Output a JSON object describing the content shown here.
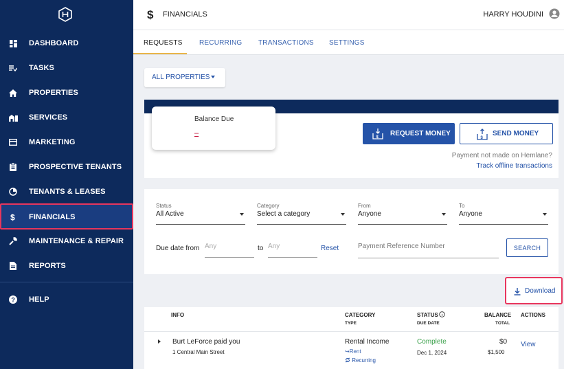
{
  "sidebar": {
    "logo_icon": "hexagon-logo-icon",
    "items": [
      {
        "label": "DASHBOARD",
        "icon": "dashboard-icon"
      },
      {
        "label": "TASKS",
        "icon": "tasks-icon"
      },
      {
        "label": "PROPERTIES",
        "icon": "home-icon"
      },
      {
        "label": "SERVICES",
        "icon": "services-icon"
      },
      {
        "label": "MARKETING",
        "icon": "marketing-icon"
      },
      {
        "label": "PROSPECTIVE TENANTS",
        "icon": "clipboard-icon"
      },
      {
        "label": "TENANTS & LEASES",
        "icon": "pie-icon"
      },
      {
        "label": "FINANCIALS",
        "icon": "dollar-icon",
        "active": true
      },
      {
        "label": "MAINTENANCE & REPAIR",
        "icon": "wrench-icon"
      },
      {
        "label": "REPORTS",
        "icon": "report-icon"
      }
    ],
    "help": {
      "label": "HELP",
      "icon": "help-icon"
    }
  },
  "header": {
    "title": "FINANCIALS",
    "user_name": "HARRY HOUDINI"
  },
  "tabs": [
    {
      "label": "REQUESTS",
      "active": true
    },
    {
      "label": "RECURRING"
    },
    {
      "label": "TRANSACTIONS"
    },
    {
      "label": "SETTINGS"
    }
  ],
  "property_filter": {
    "label": "ALL PROPERTIES"
  },
  "balance": {
    "title": "Balance Due",
    "value": "–",
    "request_label": "REQUEST MONEY",
    "send_label": "SEND MONEY",
    "offline_note": "Payment not made on Hemlane?",
    "offline_link": "Track offline transactions"
  },
  "filters": {
    "status": {
      "caption": "Status",
      "value": "All Active"
    },
    "category": {
      "caption": "Category",
      "value": "Select a category"
    },
    "from": {
      "caption": "From",
      "value": "Anyone"
    },
    "to": {
      "caption": "To",
      "value": "Anyone"
    },
    "due_label": "Due date from",
    "date_from_placeholder": "Any",
    "to_label": "to",
    "date_to_placeholder": "Any",
    "reset_label": "Reset",
    "payref_placeholder": "Payment Reference Number",
    "search_label": "SEARCH"
  },
  "download": {
    "label": "Download"
  },
  "table": {
    "headers": {
      "info": "INFO",
      "category": "CATEGORY",
      "category_sub": "TYPE",
      "status": "STATUS",
      "status_sub": "DUE DATE",
      "balance": "BALANCE",
      "balance_sub": "TOTAL",
      "actions": "ACTIONS"
    },
    "rows": [
      {
        "title": "Burt LeForce paid you",
        "address": "1 Central Main Street",
        "category": "Rental Income",
        "type": "↪Rent",
        "recurring": "Recurring",
        "status": "Complete",
        "due_date": "Dec 1, 2024",
        "balance": "$0",
        "total": "$1,500",
        "action": "View"
      }
    ]
  },
  "colors": {
    "sidebar_bg": "#0d2a5c",
    "accent_blue": "#2553a8",
    "highlight": "#e8365d",
    "complete_green": "#3aa04a"
  }
}
